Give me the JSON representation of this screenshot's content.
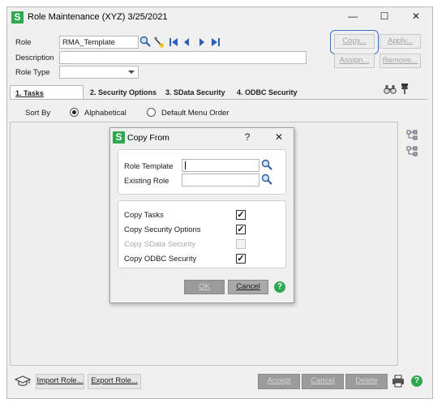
{
  "window": {
    "title": "Role Maintenance (XYZ) 3/25/2021",
    "logo": "S",
    "minimize": "—",
    "maximize": "☐",
    "close": "✕"
  },
  "header": {
    "role_label": "Role",
    "role_value": "RMA_Template",
    "description_label": "Description",
    "description_value": "",
    "role_type_label": "Role Type",
    "role_type_value": ""
  },
  "top_buttons": {
    "copy": "Copy...",
    "apply": "Apply...",
    "assign": "Assign...",
    "remove": "Remove..."
  },
  "tabs": [
    {
      "label": "1. Tasks"
    },
    {
      "label": "2. Security Options"
    },
    {
      "label": "3. SData Security"
    },
    {
      "label": "4. ODBC Security"
    }
  ],
  "sort": {
    "label": "Sort By",
    "option_alpha": "Alphabetical",
    "option_menu": "Default Menu Order",
    "selected": "Alphabetical"
  },
  "dialog": {
    "logo": "S",
    "title": "Copy From",
    "help": "?",
    "close": "✕",
    "role_template_label": "Role Template",
    "role_template_value": "",
    "existing_role_label": "Existing Role",
    "existing_role_value": "",
    "options": [
      {
        "label": "Copy Tasks",
        "checked": true,
        "enabled": true
      },
      {
        "label": "Copy Security Options",
        "checked": true,
        "enabled": true
      },
      {
        "label": "Copy SData Security",
        "checked": false,
        "enabled": false
      },
      {
        "label": "Copy ODBC Security",
        "checked": true,
        "enabled": true
      }
    ],
    "ok": "OK",
    "cancel": "Cancel"
  },
  "bottom_buttons": {
    "import_role": "Import Role...",
    "export_role": "Export Role...",
    "accept": "Accept",
    "cancel": "Cancel",
    "delete": "Delete"
  },
  "colors": {
    "sage_green": "#2fa84f",
    "highlight_blue": "#3d6fb8",
    "nav_blue": "#2f5fb5"
  }
}
